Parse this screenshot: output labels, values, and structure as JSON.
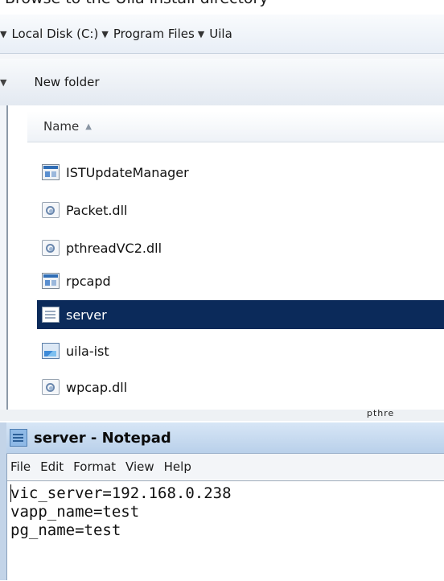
{
  "explorer": {
    "cropped_title_text": "Browse to the Uila install directory",
    "breadcrumb": {
      "items": [
        "Local Disk (C:)",
        "Program Files",
        "Uila"
      ]
    },
    "toolbar": {
      "new_folder_label": "New folder"
    },
    "column_header": {
      "name_label": "Name"
    },
    "files": [
      {
        "name": "ISTUpdateManager",
        "icon": "application-icon",
        "selected": false
      },
      {
        "name": "Packet.dll",
        "icon": "dll-file-icon",
        "selected": false
      },
      {
        "name": "pthreadVC2.dll",
        "icon": "dll-file-icon",
        "selected": false
      },
      {
        "name": "rpcapd",
        "icon": "application-icon",
        "selected": false
      },
      {
        "name": "server",
        "icon": "text-file-icon",
        "selected": true
      },
      {
        "name": "uila-ist",
        "icon": "image-file-icon",
        "selected": false
      },
      {
        "name": "wpcap.dll",
        "icon": "dll-file-icon",
        "selected": false
      }
    ],
    "peek_text": "pthre",
    "colors": {
      "selection": "#0b2a5a",
      "toolbar": "#e3e9f1"
    }
  },
  "notepad": {
    "title": "server - Notepad",
    "menu": [
      "File",
      "Edit",
      "Format",
      "View",
      "Help"
    ],
    "lines": [
      "vic_server=192.168.0.238",
      "vapp_name=test",
      "pg_name=test"
    ],
    "colors": {
      "title_bar": "#c8dbf0"
    }
  }
}
